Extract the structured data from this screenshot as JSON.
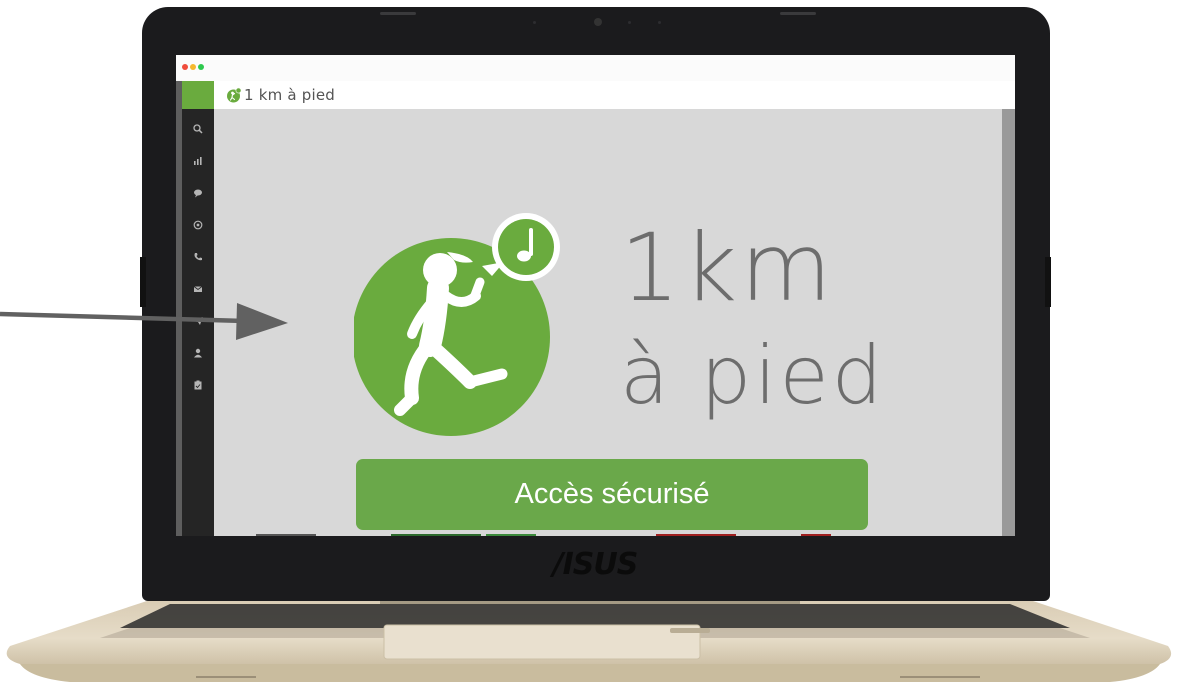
{
  "screen": {
    "app_title": "1 km à pied",
    "hero": {
      "line1": "1km",
      "line2": "à pied"
    },
    "cta_label": "Accès sécurisé",
    "sidebar": {
      "icons": [
        "search-icon",
        "bar-chart-icon",
        "chat-bubble-icon",
        "at-sign-icon",
        "phone-icon",
        "envelope-icon",
        "send-icon",
        "user-icon",
        "clipboard-icon"
      ]
    }
  },
  "device": {
    "brand": "/ISUS"
  },
  "colors": {
    "accent_green": "#6aa84a",
    "logo_green": "#6aab3e",
    "sidebar_bg": "#252525",
    "content_bg": "#d8d8d8",
    "text_grey": "#6d6d6d"
  }
}
